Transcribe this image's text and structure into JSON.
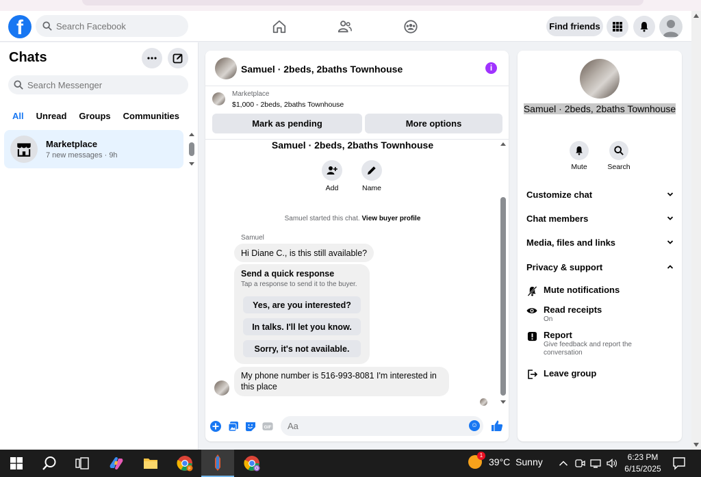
{
  "facebook": {
    "search_placeholder": "Search Facebook",
    "find_friends_label": "Find friends"
  },
  "chats": {
    "title": "Chats",
    "search_placeholder": "Search Messenger",
    "tabs": [
      {
        "label": "All",
        "active": true
      },
      {
        "label": "Unread",
        "active": false
      },
      {
        "label": "Groups",
        "active": false
      },
      {
        "label": "Communities",
        "active": false
      }
    ],
    "items": [
      {
        "name": "Marketplace",
        "subtitle": "7 new messages · 9h"
      }
    ]
  },
  "conversation": {
    "title": "Samuel · 2beds, 2baths Townhouse",
    "marketplace_label": "Marketplace",
    "listing": "$1,000 - 2beds, 2baths Townhouse",
    "mark_pending_label": "Mark as pending",
    "more_options_label": "More options",
    "thread_title": "Samuel · 2beds, 2baths Townhouse",
    "actions": [
      {
        "label": "Add",
        "icon": "add-person-icon"
      },
      {
        "label": "Name",
        "icon": "pencil-icon"
      }
    ],
    "started_text": "Samuel started this chat.",
    "buyer_profile_link": "View buyer profile",
    "sender_name": "Samuel",
    "messages": [
      {
        "text": "Hi Diane C., is this still available?"
      },
      {
        "text": "My phone number is 516-993-8081 I'm interested in this place"
      }
    ],
    "quick_response": {
      "title": "Send a quick response",
      "subtitle": "Tap a response to send it to the buyer.",
      "options": [
        "Yes, are you interested?",
        "In talks. I'll let you know.",
        "Sorry, it's not available."
      ]
    },
    "composer_placeholder": "Aa"
  },
  "details": {
    "name": "Samuel · 2beds, 2baths Townhouse",
    "actions": [
      {
        "label": "Mute",
        "icon": "bell-icon"
      },
      {
        "label": "Search",
        "icon": "search-icon"
      }
    ],
    "sections": [
      {
        "label": "Customize chat",
        "expanded": false
      },
      {
        "label": "Chat members",
        "expanded": false
      },
      {
        "label": "Media, files and links",
        "expanded": false
      },
      {
        "label": "Privacy & support",
        "expanded": true
      }
    ],
    "privacy_items": [
      {
        "label": "Mute notifications",
        "sub": "",
        "icon": "bell-off-icon"
      },
      {
        "label": "Read receipts",
        "sub": "On",
        "icon": "eye-icon"
      },
      {
        "label": "Report",
        "sub": "Give feedback and report the conversation",
        "icon": "report-icon"
      },
      {
        "label": "Leave group",
        "sub": "",
        "icon": "leave-icon"
      }
    ]
  },
  "taskbar": {
    "weather_temp": "39°C",
    "weather_cond": "Sunny",
    "weather_badge": "1",
    "time": "6:23 PM",
    "date": "6/15/2025"
  },
  "colors": {
    "facebook_blue": "#1877f2",
    "info_purple": "#a033ff",
    "active_chat_bg": "#e7f3ff"
  }
}
